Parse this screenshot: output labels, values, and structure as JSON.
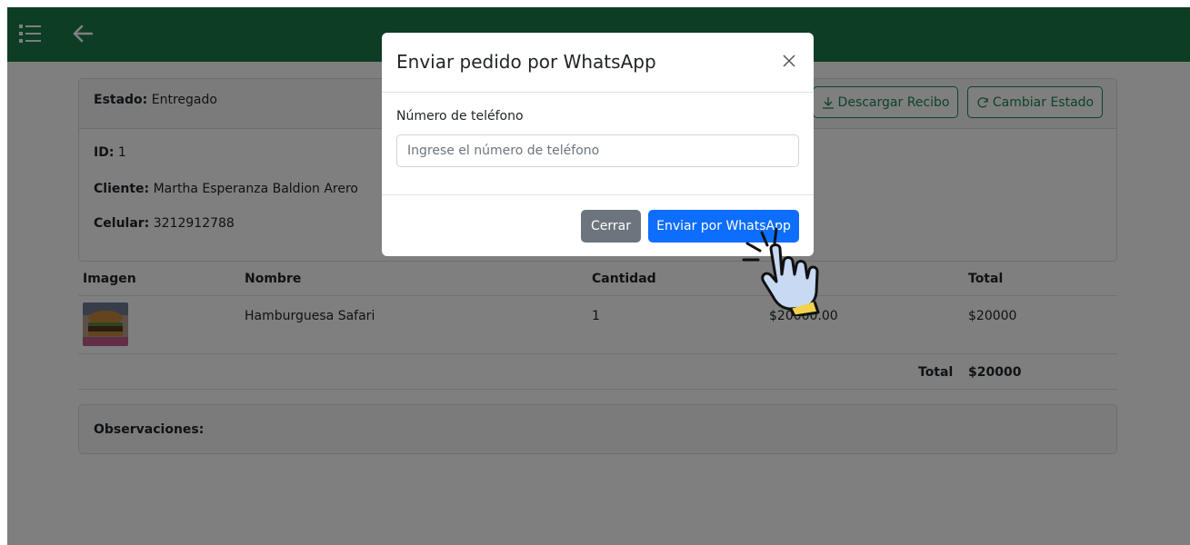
{
  "navbar": {
    "menu_icon": "list-icon",
    "back_icon": "arrow-left-icon",
    "bg_color": "#1d7a4a"
  },
  "order": {
    "estado_label": "Estado:",
    "estado_value": "Entregado",
    "download_button": "Descargar Recibo",
    "change_status_button": "Cambiar Estado",
    "id_label": "ID:",
    "id_value": "1",
    "cliente_label": "Cliente:",
    "cliente_value": "Martha Esperanza Baldion Arero",
    "celular_label": "Celular:",
    "celular_value": "3212912788"
  },
  "table": {
    "headers": [
      "Imagen",
      "Nombre",
      "Cantidad",
      "Total"
    ],
    "rows": [
      {
        "nombre": "Hamburguesa Safari",
        "cantidad": "1",
        "precio": "$20000.00",
        "total": "$20000"
      }
    ],
    "total_label": "Total",
    "total_value": "$20000"
  },
  "observaciones": {
    "label": "Observaciones:"
  },
  "modal": {
    "title": "Enviar pedido por WhatsApp",
    "phone_label": "Número de teléfono",
    "phone_placeholder": "Ingrese el número de teléfono",
    "phone_value": "",
    "close_button": "Cerrar",
    "send_button": "Enviar por WhatsApp",
    "close_icon": "close-icon"
  },
  "colors": {
    "accent_green": "#198754",
    "primary_blue": "#0d6efd",
    "secondary_gray": "#6c757d"
  }
}
